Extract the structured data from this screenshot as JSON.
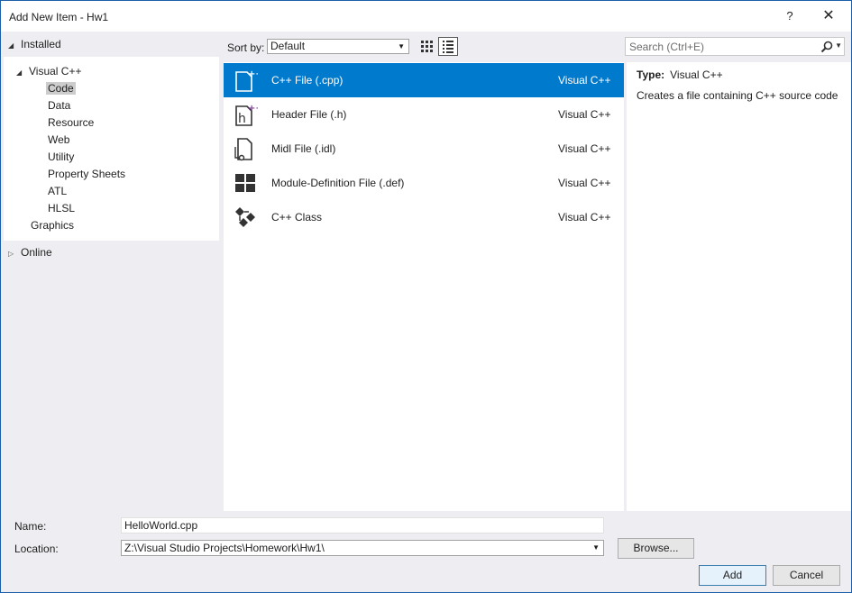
{
  "window": {
    "title": "Add New Item - Hw1",
    "help_label": "?",
    "close_label": "✕"
  },
  "left": {
    "installed_label": "Installed",
    "tree": [
      {
        "label": "Visual C++",
        "level": 0,
        "expanded": true
      },
      {
        "label": "Code",
        "level": 1,
        "selected": true
      },
      {
        "label": "Data",
        "level": 1
      },
      {
        "label": "Resource",
        "level": 1
      },
      {
        "label": "Web",
        "level": 1
      },
      {
        "label": "Utility",
        "level": 1
      },
      {
        "label": "Property Sheets",
        "level": 1
      },
      {
        "label": "ATL",
        "level": 1
      },
      {
        "label": "HLSL",
        "level": 1
      },
      {
        "label": "Graphics",
        "level": 0
      }
    ],
    "online_label": "Online"
  },
  "toolbar": {
    "sort_label": "Sort by:",
    "sort_value": "Default"
  },
  "search": {
    "placeholder": "Search (Ctrl+E)"
  },
  "templates": [
    {
      "name": "C++ File (.cpp)",
      "lang": "Visual C++",
      "icon": "cpp-file-icon",
      "selected": true
    },
    {
      "name": "Header File (.h)",
      "lang": "Visual C++",
      "icon": "header-file-icon"
    },
    {
      "name": "Midl File (.idl)",
      "lang": "Visual C++",
      "icon": "midl-file-icon"
    },
    {
      "name": "Module-Definition File (.def)",
      "lang": "Visual C++",
      "icon": "module-definition-icon"
    },
    {
      "name": "C++ Class",
      "lang": "Visual C++",
      "icon": "cpp-class-icon"
    }
  ],
  "details": {
    "type_label": "Type:",
    "type_value": "Visual C++",
    "description": "Creates a file containing C++ source code"
  },
  "form": {
    "name_label": "Name:",
    "name_value": "HelloWorld.cpp",
    "location_label": "Location:",
    "location_value": "Z:\\Visual Studio Projects\\Homework\\Hw1\\",
    "browse_label": "Browse...",
    "add_label": "Add",
    "cancel_label": "Cancel"
  },
  "colors": {
    "selection": "#007acc",
    "window_border": "#1c5fa8",
    "background": "#eeeef2"
  }
}
